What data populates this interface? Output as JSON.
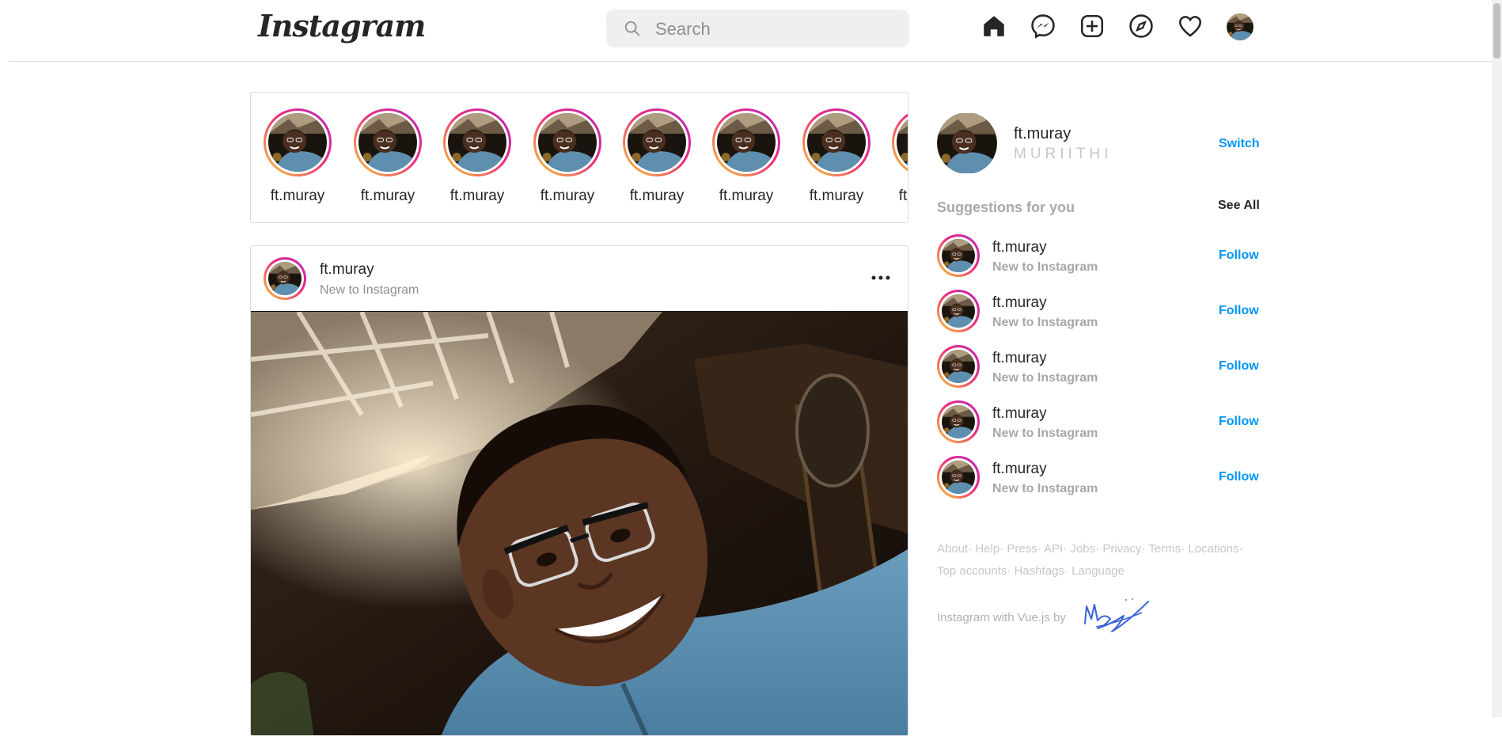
{
  "header": {
    "logo": "Instagram",
    "search_placeholder": "Search",
    "icons": [
      "home-icon",
      "messenger-icon",
      "new-post-icon",
      "explore-icon",
      "activity-heart-icon",
      "profile-avatar"
    ]
  },
  "stories": [
    {
      "username": "ft.muray"
    },
    {
      "username": "ft.muray"
    },
    {
      "username": "ft.muray"
    },
    {
      "username": "ft.muray"
    },
    {
      "username": "ft.muray"
    },
    {
      "username": "ft.muray"
    },
    {
      "username": "ft.muray"
    },
    {
      "username": "ft.muray"
    }
  ],
  "post": {
    "username": "ft.muray",
    "subtitle": "New to Instagram"
  },
  "sidebar": {
    "username": "ft.muray",
    "name": "MURIITHI",
    "switch_label": "Switch",
    "suggestions_title": "Suggestions for you",
    "see_all_label": "See All",
    "suggestions": [
      {
        "username": "ft.muray",
        "subtitle": "New to Instagram",
        "action": "Follow"
      },
      {
        "username": "ft.muray",
        "subtitle": "New to Instagram",
        "action": "Follow"
      },
      {
        "username": "ft.muray",
        "subtitle": "New to Instagram",
        "action": "Follow"
      },
      {
        "username": "ft.muray",
        "subtitle": "New to Instagram",
        "action": "Follow"
      },
      {
        "username": "ft.muray",
        "subtitle": "New to Instagram",
        "action": "Follow"
      }
    ],
    "footer_links": [
      "About",
      "Help",
      "Press",
      "API",
      "Jobs",
      "Privacy",
      "Terms",
      "Locations",
      "Top accounts",
      "Hashtags",
      "Language"
    ],
    "credit": "Instagram with Vue.js by"
  },
  "colors": {
    "link_blue": "#0095f6",
    "muted": "#8e8e8e",
    "border": "#dbdbdb",
    "story_ring_start": "#f9ce34",
    "story_ring_end": "#b62bbf"
  }
}
